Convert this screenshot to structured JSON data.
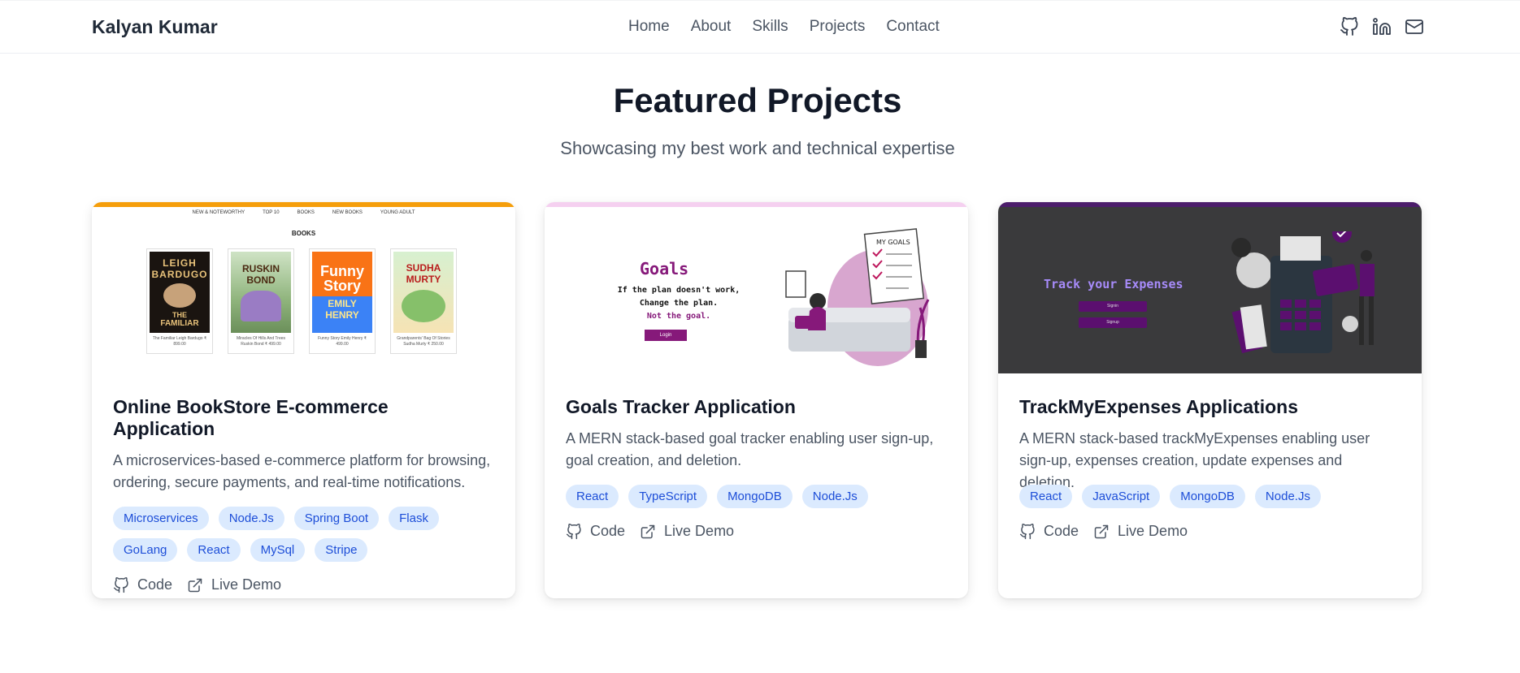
{
  "nav": {
    "brand": "Kalyan Kumar",
    "links": [
      "Home",
      "About",
      "Skills",
      "Projects",
      "Contact"
    ],
    "social_icons": [
      "github-icon",
      "linkedin-icon",
      "mail-icon"
    ]
  },
  "section": {
    "title": "Featured Projects",
    "subtitle": "Showcasing my best work and technical expertise"
  },
  "projects": [
    {
      "title": "Online BookStore E-commerce Application",
      "description": "A microservices-based e-commerce platform for browsing, ordering, secure payments, and real-time notifications.",
      "tags": [
        "Microservices",
        "Node.Js",
        "Spring Boot",
        "Flask",
        "GoLang",
        "React",
        "MySql",
        "Stripe"
      ],
      "accent": "#f59e0b",
      "code_label": "Code",
      "demo_label": "Live Demo",
      "preview": {
        "nav": [
          "NEW & NOTEWORTHY",
          "TOP 10",
          "BOOKS",
          "NEW BOOKS",
          "YOUNG ADULT"
        ],
        "heading": "BOOKS",
        "books": [
          {
            "cover_lines": [
              "LEIGH",
              "BARDUGO",
              "THE",
              "FAMILIAR"
            ],
            "caption": "The Familiar Leigh Bardugo ₹ 899.00"
          },
          {
            "cover_lines": [
              "RUSKIN",
              "BOND"
            ],
            "caption": "Miracles Of Hills And Trees Ruskin Bond ₹ 499.00"
          },
          {
            "cover_lines": [
              "Funny",
              "Story",
              "EMILY",
              "HENRY"
            ],
            "caption": "Funny Story Emily Henry ₹ 499.00"
          },
          {
            "cover_lines": [
              "SUDHA",
              "MURTY"
            ],
            "caption": "Grandparents' Bag Of Stories Sudha Murty ₹ 250.00"
          }
        ]
      }
    },
    {
      "title": "Goals Tracker Application",
      "description": "A MERN stack-based goal tracker enabling user sign-up, goal creation, and deletion.",
      "tags": [
        "React",
        "TypeScript",
        "MongoDB",
        "Node.Js"
      ],
      "accent": "#f5d0f0",
      "code_label": "Code",
      "demo_label": "Live Demo",
      "preview": {
        "heading": "Goals",
        "lines": [
          "If the plan doesn't work,",
          "Change the plan.",
          "Not the goal."
        ],
        "button": "Login",
        "board_label": "MY GOALS"
      }
    },
    {
      "title": "TrackMyExpenses Applications",
      "description": "A MERN stack-based trackMyExpenses enabling user sign-up, expenses creation, update expenses and deletion.",
      "tags": [
        "React",
        "JavaScript",
        "MongoDB",
        "Node.Js"
      ],
      "accent": "#4c1d6b",
      "code_label": "Code",
      "demo_label": "Live Demo",
      "preview": {
        "heading": "Track your Expenses",
        "buttons": [
          "Signin",
          "Signup"
        ]
      }
    }
  ]
}
